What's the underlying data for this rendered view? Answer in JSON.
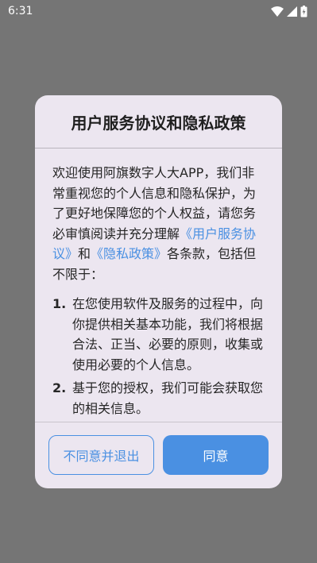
{
  "status_bar": {
    "time": "6:31"
  },
  "dialog": {
    "title": "用户服务协议和隐私政策",
    "intro_before": "欢迎使用阿旗数字人大APP，我们非常重视您的个人信息和隐私保护，为了更好地保障您的个人权益，请您务必审慎阅读并充分理解",
    "link_user_agreement": "《用户服务协议》",
    "intro_and": "和",
    "link_privacy_policy": "《隐私政策》",
    "intro_after": "各条款，包括但不限于：",
    "items": [
      {
        "num": "1.",
        "text": "在您使用软件及服务的过程中，向你提供相关基本功能，我们将根据合法、正当、必要的原则，收集或使用必要的个人信息。"
      },
      {
        "num": "2.",
        "text": "基于您的授权，我们可能会获取您的相关信息。"
      }
    ],
    "buttons": {
      "disagree": "不同意并退出",
      "agree": "同意"
    },
    "colors": {
      "accent": "#4a90e2",
      "dialog_bg": "#ece6f0",
      "scrim": "#757575"
    }
  },
  "icons": [
    "wifi-icon",
    "signal-icon",
    "battery-icon"
  ]
}
